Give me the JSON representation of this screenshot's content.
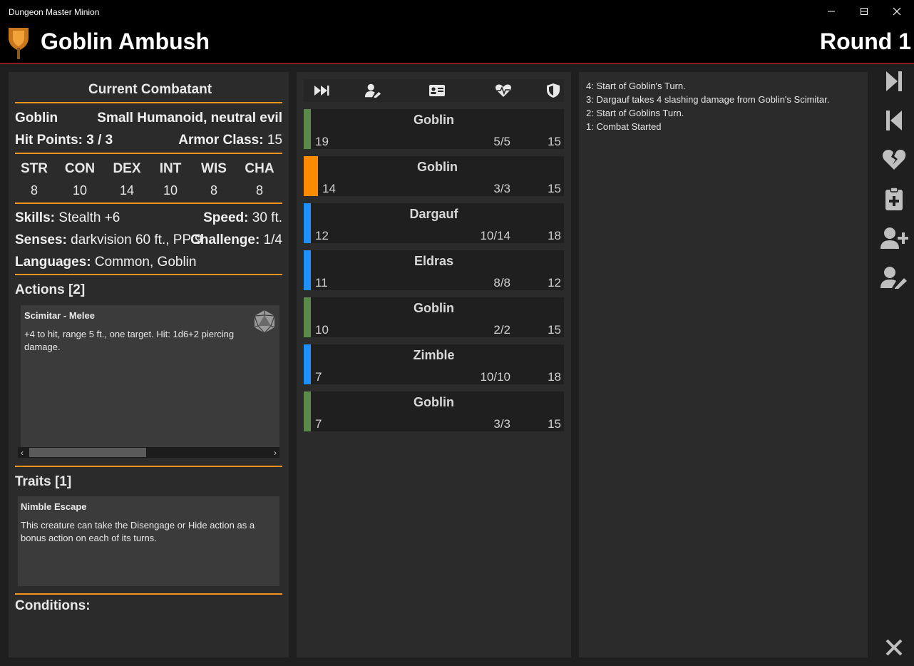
{
  "window": {
    "title": "Dungeon Master Minion"
  },
  "header": {
    "encounter_name": "Goblin Ambush",
    "round_label": "Round",
    "round_number": "1"
  },
  "combatant": {
    "section_title": "Current Combatant",
    "name": "Goblin",
    "type": "Small Humanoid, neutral evil",
    "hp_label": "Hit Points: 3 / 3",
    "ac_label": "Armor Class:",
    "ac_value": "15",
    "abilities": [
      {
        "label": "STR",
        "value": "8"
      },
      {
        "label": "CON",
        "value": "10"
      },
      {
        "label": "DEX",
        "value": "14"
      },
      {
        "label": "INT",
        "value": "10"
      },
      {
        "label": "WIS",
        "value": "8"
      },
      {
        "label": "CHA",
        "value": "8"
      }
    ],
    "skills_label": "Skills:",
    "skills_value": "Stealth +6",
    "speed_label": "Speed:",
    "speed_value": "30 ft.",
    "senses_label": "Senses:",
    "senses_value": "darkvision 60 ft., PP 9",
    "challenge_label": "Challenge:",
    "challenge_value": "1/4",
    "languages_label": "Languages:",
    "languages_value": "Common, Goblin",
    "actions_title": "Actions [2]",
    "action": {
      "name": "Scimitar - Melee",
      "desc": "+4 to hit, range 5 ft., one target. Hit: 1d6+2 piercing damage.",
      "icon": "d20-icon"
    },
    "traits_title": "Traits [1]",
    "trait": {
      "name": "Nimble Escape",
      "desc": "This creature can take the Disengage or Hide action as a bonus action on each of its turns."
    },
    "conditions_title": "Conditions:"
  },
  "initiative": {
    "header_icons": [
      "fast-forward-icon",
      "user-edit-icon",
      "id-card-icon",
      "heartbeat-icon",
      "shield-icon"
    ],
    "rows": [
      {
        "name": "Goblin",
        "initiative": "19",
        "hp": "5/5",
        "ac": "15",
        "color": "#5a8a4a",
        "active": false
      },
      {
        "name": "Goblin",
        "initiative": "14",
        "hp": "3/3",
        "ac": "15",
        "color": "#ff8c00",
        "active": true
      },
      {
        "name": "Dargauf",
        "initiative": "12",
        "hp": "10/14",
        "ac": "18",
        "color": "#1e90ff",
        "active": false
      },
      {
        "name": "Eldras",
        "initiative": "11",
        "hp": "8/8",
        "ac": "12",
        "color": "#1e90ff",
        "active": false
      },
      {
        "name": "Goblin",
        "initiative": "10",
        "hp": "2/2",
        "ac": "15",
        "color": "#5a8a4a",
        "active": false
      },
      {
        "name": "Zimble",
        "initiative": "7",
        "hp": "10/10",
        "ac": "18",
        "color": "#1e90ff",
        "active": false
      },
      {
        "name": "Goblin",
        "initiative": "7",
        "hp": "3/3",
        "ac": "15",
        "color": "#5a8a4a",
        "active": false
      }
    ]
  },
  "log": [
    "4: Start of Goblin's Turn.",
    "3: Dargauf takes 4 slashing damage from Goblin's Scimitar.",
    "2: Start of Goblins Turn.",
    "1: Combat Started"
  ],
  "toolbar": [
    "next-turn-icon",
    "previous-turn-icon",
    "heart-broken-icon",
    "clipboard-plus-icon",
    "user-plus-icon",
    "user-edit-icon",
    "close-icon"
  ],
  "colors": {
    "accent": "#f7941d",
    "header_line": "#8b1a1a",
    "panel": "#2b2b2b",
    "monster": "#5a8a4a",
    "player": "#1e90ff",
    "active": "#ff8c00"
  }
}
